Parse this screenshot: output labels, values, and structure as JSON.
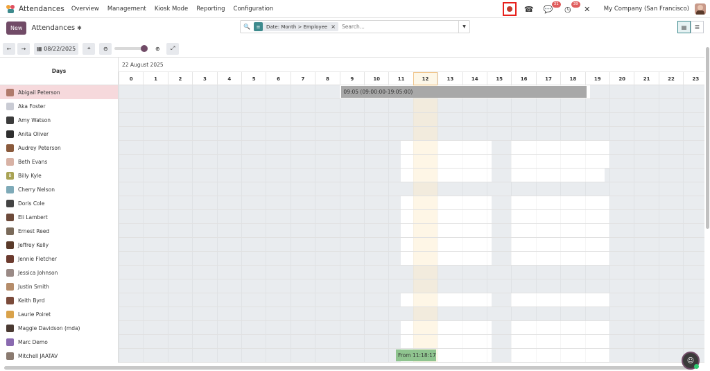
{
  "app": {
    "title": "Attendances",
    "menu": [
      "Overview",
      "Management",
      "Kiosk Mode",
      "Reporting",
      "Configuration"
    ]
  },
  "systray": {
    "messages_badge": "31",
    "activity_badge": "39",
    "company": "My Company (San Francisco)"
  },
  "control": {
    "new_label": "New",
    "breadcrumb": "Attendances",
    "facet_label": "Date: Month > Employee",
    "search_placeholder": "Search..."
  },
  "toolbar": {
    "date_label": "08/22/2025"
  },
  "gantt": {
    "days_header": "Days",
    "date_title": "22 August 2025",
    "hours": [
      "0",
      "1",
      "2",
      "3",
      "4",
      "5",
      "6",
      "7",
      "8",
      "9",
      "10",
      "11",
      "12",
      "13",
      "14",
      "15",
      "16",
      "17",
      "18",
      "19",
      "20",
      "21",
      "22",
      "23"
    ],
    "today_hour": "12",
    "employees": [
      {
        "name": "Abigail Peterson",
        "avatar_color": "#b07a6b",
        "selected": true
      },
      {
        "name": "Aka Foster",
        "avatar_color": "#c9cbd4"
      },
      {
        "name": "Amy Watson",
        "avatar_color": "#3b3b3b"
      },
      {
        "name": "Anita Oliver",
        "avatar_color": "#2f2f2f"
      },
      {
        "name": "Audrey Peterson",
        "avatar_color": "#8a5a3c"
      },
      {
        "name": "Beth Evans",
        "avatar_color": "#d8b2a5"
      },
      {
        "name": "Billy Kyle",
        "avatar_color": "#a9a354",
        "initial": "B"
      },
      {
        "name": "Cherry Nelson",
        "avatar_color": "#7eaab8"
      },
      {
        "name": "Doris Cole",
        "avatar_color": "#444444"
      },
      {
        "name": "Eli Lambert",
        "avatar_color": "#6d4a3a"
      },
      {
        "name": "Ernest Reed",
        "avatar_color": "#7a6a5a"
      },
      {
        "name": "Jeffrey Kelly",
        "avatar_color": "#5a3a2a"
      },
      {
        "name": "Jennie Fletcher",
        "avatar_color": "#6b3a2e"
      },
      {
        "name": "Jessica Johnson",
        "avatar_color": "#9a8a86"
      },
      {
        "name": "Justin Smith",
        "avatar_color": "#b58c6a"
      },
      {
        "name": "Keith Byrd",
        "avatar_color": "#7a4a3a"
      },
      {
        "name": "Laurie Poiret",
        "avatar_color": "#d9a24a"
      },
      {
        "name": "Maggie Davidson (mda)",
        "avatar_color": "#4a3a32"
      },
      {
        "name": "Marc Demo",
        "avatar_color": "#8a6ab0"
      },
      {
        "name": "Mitchell JAATAV",
        "avatar_color": "#8a7a70"
      }
    ],
    "bars": [
      {
        "label": "09:05 (09:00:00-19:05:00)",
        "row": 0,
        "start_hour": 9.08,
        "end_hour": 19.08,
        "color": "#a8a8a8"
      },
      {
        "label": "From 11:18:17",
        "row": 19,
        "start_hour": 11.3,
        "end_hour": 12.95,
        "color": "#8fc48f"
      }
    ]
  }
}
